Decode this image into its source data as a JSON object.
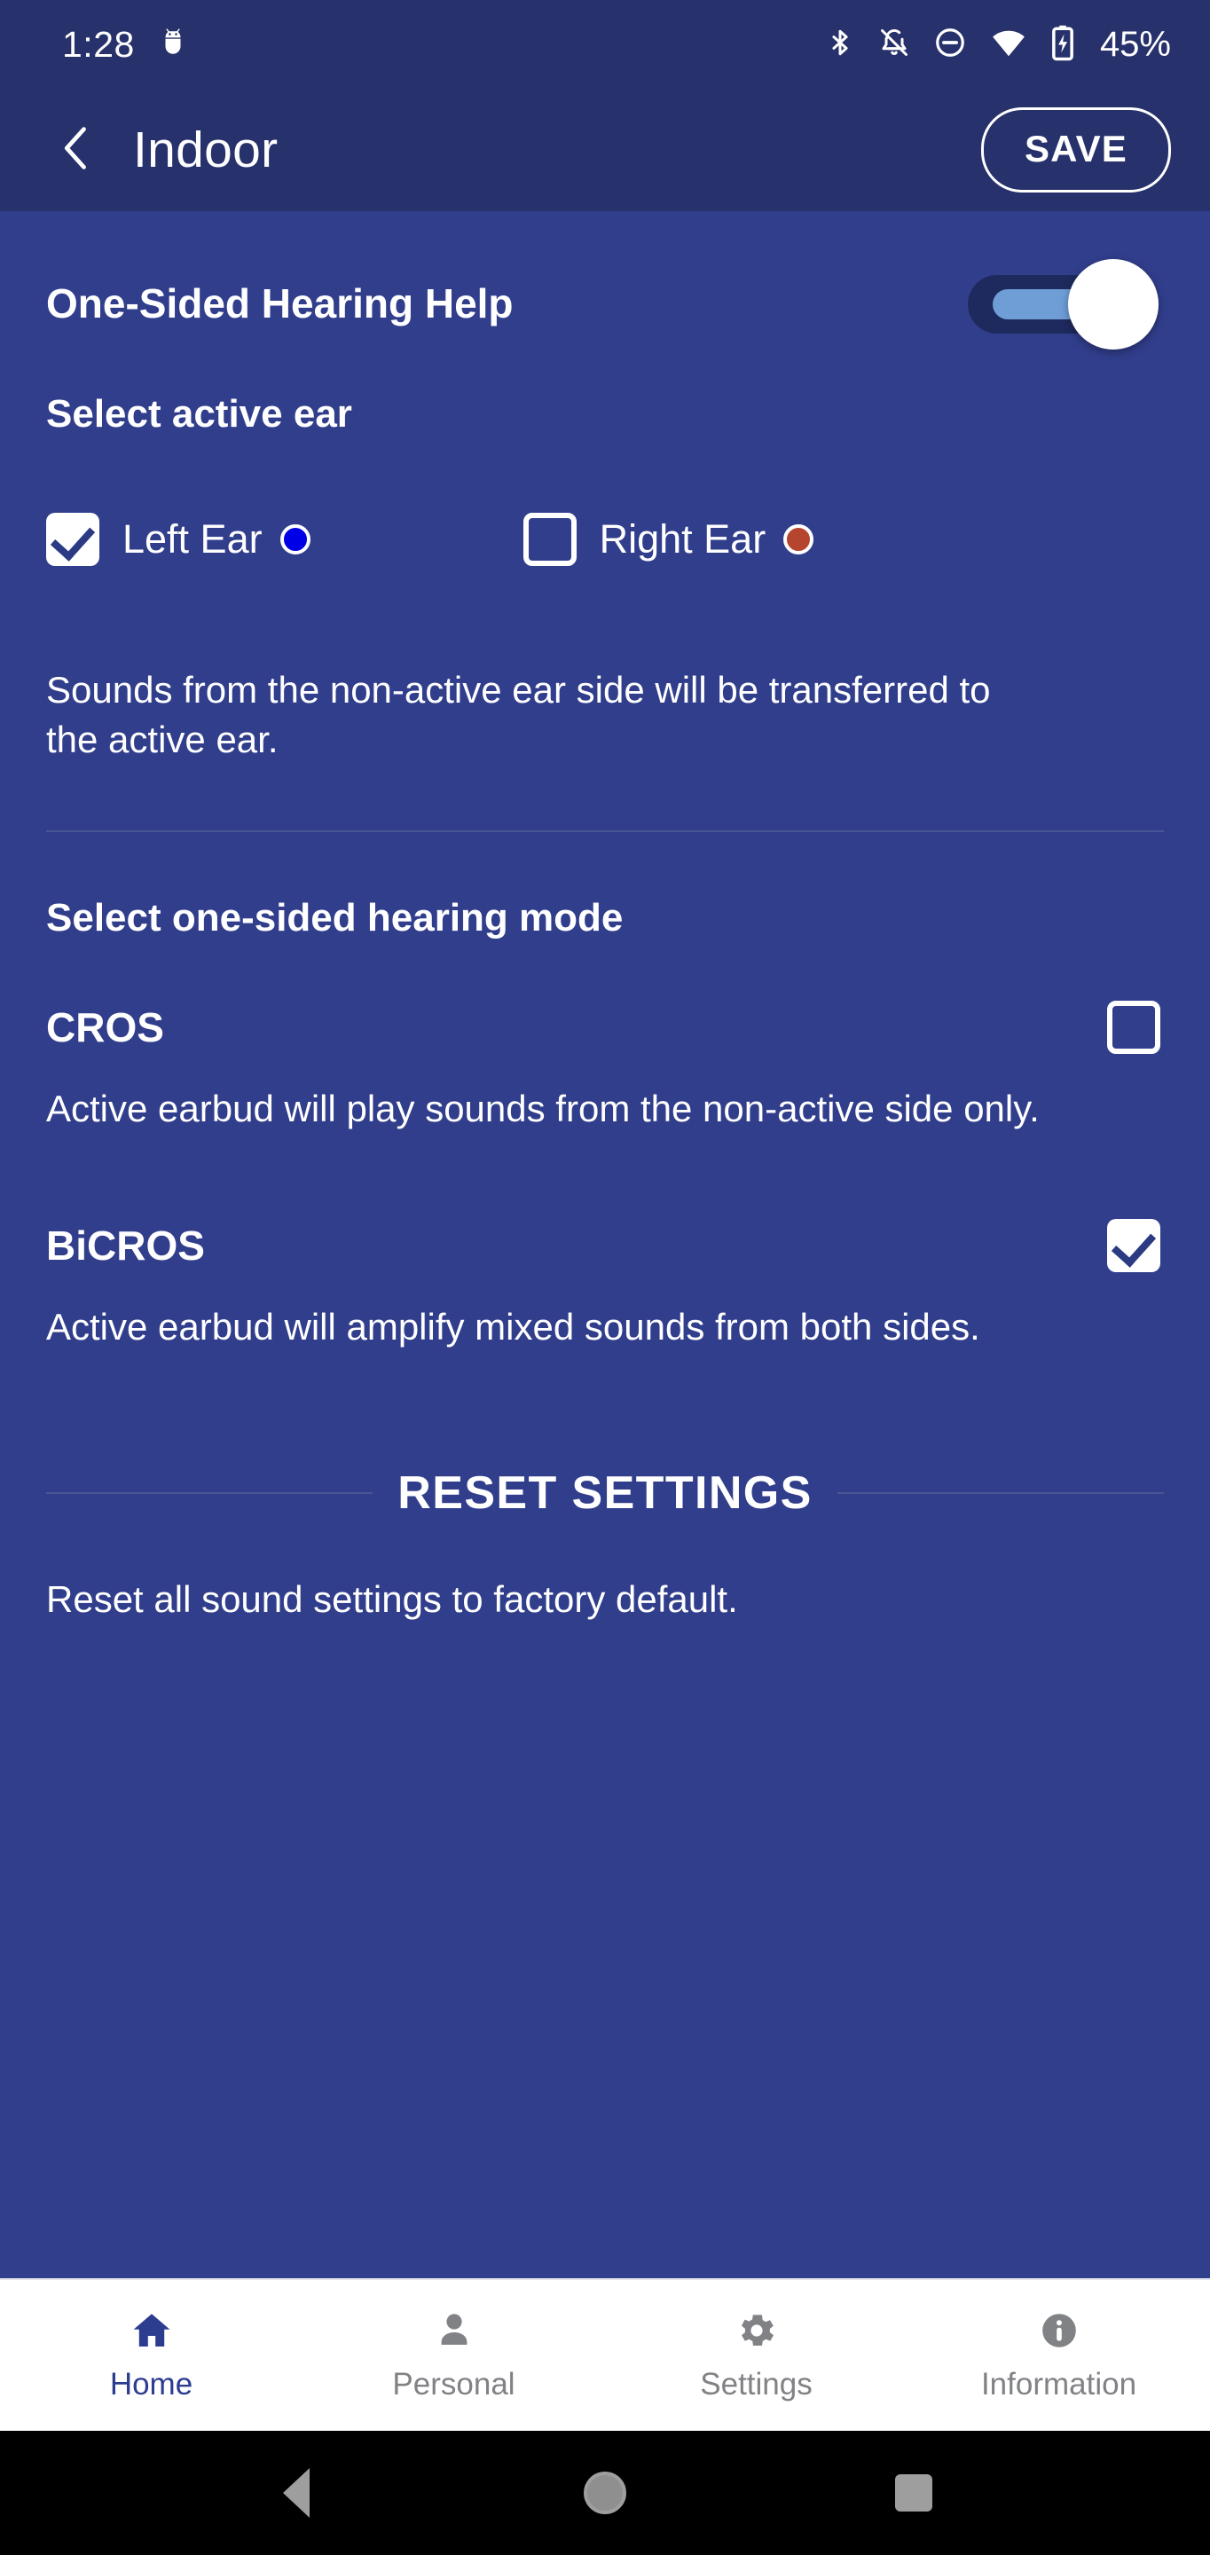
{
  "status_bar": {
    "time": "1:28",
    "battery_percent": "45%",
    "icons": [
      "android-debug-icon",
      "bluetooth-icon",
      "notifications-off-icon",
      "do-not-disturb-icon",
      "wifi-icon",
      "battery-charging-icon"
    ]
  },
  "app_bar": {
    "back_icon": "chevron-left-icon",
    "title": "Indoor",
    "save_label": "SAVE"
  },
  "main": {
    "toggle_row": {
      "label": "One-Sided Hearing Help",
      "enabled": true
    },
    "active_ear": {
      "title": "Select active ear",
      "options": [
        {
          "label": "Left Ear",
          "checked": true,
          "dot_color": "#0000e6"
        },
        {
          "label": "Right Ear",
          "checked": false,
          "dot_color": "#b5452f"
        }
      ],
      "description": "Sounds from the non-active ear side will be transferred to the active ear."
    },
    "hearing_mode": {
      "title": "Select one-sided hearing mode",
      "modes": [
        {
          "name": "CROS",
          "checked": false,
          "description": "Active earbud will play sounds from the non-active side only."
        },
        {
          "name": "BiCROS",
          "checked": true,
          "description": "Active earbud will amplify mixed sounds from both sides."
        }
      ]
    },
    "reset": {
      "title": "RESET SETTINGS",
      "description": "Reset all sound settings to factory default."
    }
  },
  "tab_bar": {
    "items": [
      {
        "label": "Home",
        "icon": "home-icon",
        "active": true
      },
      {
        "label": "Personal",
        "icon": "person-icon",
        "active": false
      },
      {
        "label": "Settings",
        "icon": "gear-icon",
        "active": false
      },
      {
        "label": "Information",
        "icon": "info-circle-icon",
        "active": false
      }
    ]
  },
  "nav_bar": {
    "items": [
      "back-triangle-icon",
      "home-circle-icon",
      "recents-square-icon"
    ]
  },
  "colors": {
    "header_bg": "#27316b",
    "body_bg": "#313e8c",
    "accent": "#6f9ed7",
    "tab_active": "#2c3c8e"
  }
}
